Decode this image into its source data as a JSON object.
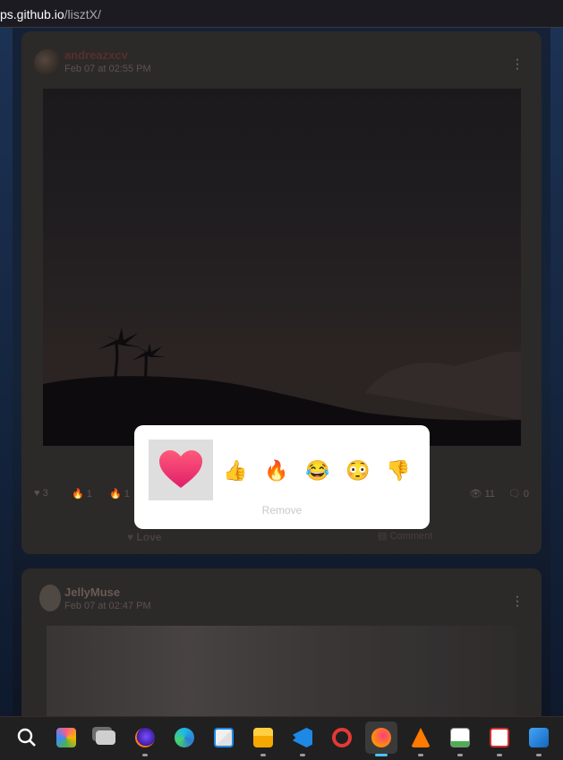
{
  "browser": {
    "url_host": "ps.github.io",
    "url_path": "/lisztX/"
  },
  "feed": {
    "posts": [
      {
        "username": "andreazxcv",
        "time": "Feb 07 at 02:55 PM",
        "reactions": [
          {
            "icon": "heart-icon",
            "count": "3"
          },
          {
            "icon": "fire-icon",
            "count": "1"
          },
          {
            "icon": "fire-icon",
            "count": "1"
          }
        ],
        "views": "11",
        "comments": "0",
        "love_label": "Love",
        "comment_label": "Comment"
      },
      {
        "username": "JellyMuse",
        "time": "Feb 07 at 02:47 PM"
      }
    ]
  },
  "reaction_popup": {
    "options": [
      {
        "name": "heart",
        "glyph": "❤",
        "selected": true
      },
      {
        "name": "thumbs-up",
        "glyph": "👍",
        "selected": false
      },
      {
        "name": "fire",
        "glyph": "🔥",
        "selected": false
      },
      {
        "name": "laughing",
        "glyph": "😂",
        "selected": false
      },
      {
        "name": "flushed",
        "glyph": "😳",
        "selected": false
      },
      {
        "name": "thumbs-down",
        "glyph": "👎",
        "selected": false
      }
    ],
    "remove_label": "Remove"
  },
  "taskbar": {
    "apps": [
      {
        "icon": "search-icon"
      },
      {
        "icon": "copilot-icon"
      },
      {
        "icon": "task-view-icon"
      },
      {
        "icon": "firefox-icon"
      },
      {
        "icon": "edge-icon"
      },
      {
        "icon": "store-icon"
      },
      {
        "icon": "file-explorer-icon"
      },
      {
        "icon": "vscode-icon"
      },
      {
        "icon": "opera-icon"
      },
      {
        "icon": "firefox-active-icon",
        "active": true
      },
      {
        "icon": "vlc-icon"
      },
      {
        "icon": "notepad-icon"
      },
      {
        "icon": "snipping-tool-icon"
      },
      {
        "icon": "paint-icon"
      }
    ]
  },
  "colors": {
    "popup_bg": "#ffffff",
    "taskbar_bg": "#202020",
    "active_indicator": "#4cc2ff"
  }
}
